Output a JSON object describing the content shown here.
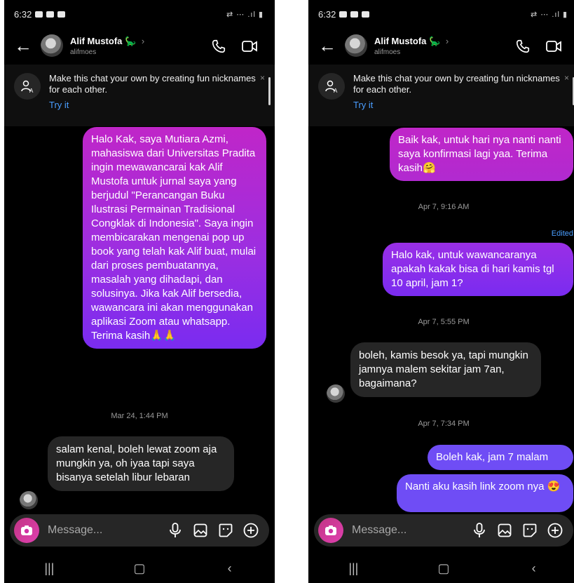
{
  "status_time": "6:32",
  "status_icons": "⇄ ⋯ .ıl ▮",
  "contact": {
    "name": "Alif Mustofa",
    "emoji": "🦕",
    "chevron": "›",
    "username": "alifmoes"
  },
  "banner": {
    "text": "Make this chat your own by creating fun nicknames for each other.",
    "action": "Try it",
    "close": "×"
  },
  "composer": {
    "placeholder": "Message..."
  },
  "colors": {
    "outgoing_top": "#c026c8",
    "outgoing_bottom": "#7a2cf0",
    "incoming": "#262626",
    "link": "#4a9eff",
    "camera": "#d12fa4"
  },
  "icons": {
    "back": "back-arrow-icon",
    "call": "phone-icon",
    "video": "video-camera-icon",
    "nickname": "nickname-icon",
    "camera": "camera-icon",
    "mic": "microphone-icon",
    "gallery": "gallery-icon",
    "sticker": "sticker-icon",
    "plus": "plus-icon"
  },
  "left_screen": {
    "messages": [
      {
        "dir": "out",
        "text": "Halo Kak, saya Mutiara Azmi, mahasiswa dari Universitas Pradita ingin mewawancarai kak Alif Mustofa untuk jurnal saya yang berjudul \"Perancangan Buku Ilustrasi Permainan Tradisional Congklak di Indonesia\". Saya ingin membicarakan mengenai pop up book yang telah kak Alif buat, mulai dari proses pembuatannya, masalah yang dihadapi, dan solusinya. Jika kak Alif bersedia, wawancara ini akan menggunakan aplikasi Zoom atau whatsapp. Terima kasih🙏🙏"
      },
      {
        "dir": "in",
        "text": "salam kenal, boleh lewat zoom aja mungkin ya, oh iyaa tapi saya bisanya setelah libur lebaran"
      }
    ],
    "timestamps": [
      "Mar 24, 1:44 PM"
    ]
  },
  "right_screen": {
    "messages": [
      {
        "dir": "out",
        "text": "Baik kak, untuk hari nya nanti nanti saya konfirmasi lagi yaa. Terima kasih🤗"
      },
      {
        "dir": "out",
        "text": "Halo kak, untuk wawancaranya apakah kakak bisa di hari kamis tgl 10 april, jam 1?"
      },
      {
        "dir": "in",
        "text": "boleh, kamis besok ya, tapi mungkin jamnya malem sekitar jam 7an, bagaimana?"
      },
      {
        "dir": "out",
        "text": "Boleh kak, jam 7 malam"
      },
      {
        "dir": "out",
        "text": "Nanti aku kasih link zoom nya 😍"
      }
    ],
    "timestamps": [
      "Apr 7, 9:16 AM",
      "Apr 7, 5:55 PM",
      "Apr 7, 7:34 PM"
    ],
    "edited_label": "Edited"
  },
  "navbar": {
    "recents": "|||",
    "home": "▢",
    "back": "‹"
  }
}
